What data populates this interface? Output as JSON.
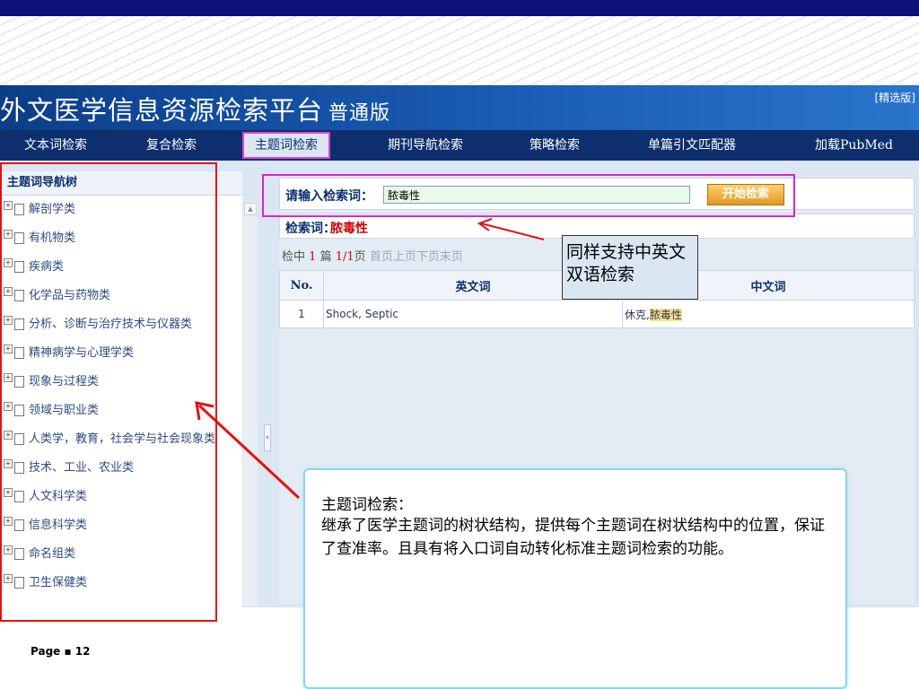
{
  "app": {
    "title": "外文医学信息资源检索平台",
    "edition": "普通版",
    "refined_link": "[精选版]"
  },
  "nav": {
    "items": [
      "文本词检索",
      "复合检索",
      "主题词检索",
      "期刊导航检索",
      "策略检索",
      "单篇引文匹配器",
      "加载PubMed"
    ],
    "active": "主题词检索"
  },
  "sidebar": {
    "title": "主题词导航树",
    "items": [
      "解剖学类",
      "有机物类",
      "疾病类",
      "化学品与药物类",
      "分析、诊断与治疗技术与仪器类",
      "精神病学与心理学类",
      "现象与过程类",
      "领域与职业类",
      "人类学，教育，社会学与社会现象类",
      "技术、工业、农业类",
      "人文科学类",
      "信息科学类",
      "命名组类",
      "卫生保健类"
    ]
  },
  "search": {
    "label": "请输入检索词：",
    "value": "脓毒性",
    "button": "开始检索"
  },
  "term": {
    "label": "检索词：",
    "value": "脓毒性"
  },
  "pager": {
    "prefix": "检中",
    "count": "1",
    "unit": "篇",
    "page": "1/1",
    "page_suffix": "页",
    "first": "首页",
    "prev": "上页",
    "next": "下页",
    "last": "末页"
  },
  "results": {
    "headers": [
      "No.",
      "英文词",
      "中文词"
    ],
    "rows": [
      {
        "no": "1",
        "en": "Shock, Septic",
        "cn_prefix": "休克,",
        "cn_highlight": "脓毒性"
      }
    ]
  },
  "annotations": {
    "bilingual_note": "同样支持中英文双语检索",
    "callout_title": "主题词检索：",
    "callout_body": "继承了医学主题词的树状结构，提供每个主题词在树状结构中的位置，保证了查准率。且具有将入口词自动转化标准主题词检索的功能。"
  },
  "footer": {
    "page_label": "Page ▪ 12"
  },
  "colors": {
    "banner": "#1a5cb4",
    "nav": "#0d2f6e",
    "highlight_box": "#e020d0",
    "annotation_red": "#e81010"
  }
}
